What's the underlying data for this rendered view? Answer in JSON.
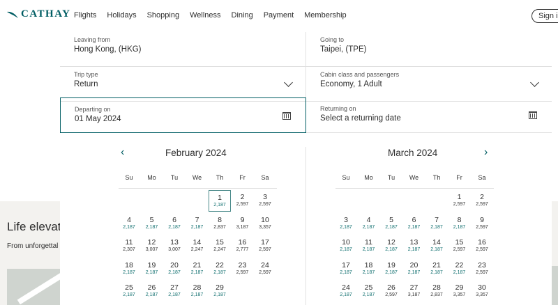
{
  "brand": {
    "name": "CATHAY",
    "accent": "#005d63"
  },
  "nav": [
    "Flights",
    "Holidays",
    "Shopping",
    "Wellness",
    "Dining",
    "Payment",
    "Membership"
  ],
  "signin": "Sign in",
  "background": {
    "heading": "Life elevat",
    "sub": "From unforgettal"
  },
  "form": {
    "leaving": {
      "label": "Leaving from",
      "value": "Hong Kong, (HKG)"
    },
    "going": {
      "label": "Going to",
      "value": "Taipei, (TPE)"
    },
    "trip": {
      "label": "Trip type",
      "value": "Return"
    },
    "cabin": {
      "label": "Cabin class and passengers",
      "value": "Economy, 1 Adult"
    },
    "depart": {
      "label": "Departing on",
      "value": "01 May 2024"
    },
    "return": {
      "label": "Returning on",
      "value": "Select a returning date"
    }
  },
  "weekdays": [
    "Su",
    "Mo",
    "Tu",
    "We",
    "Th",
    "Fr",
    "Sa"
  ],
  "months": [
    {
      "title": "February 2024",
      "start": 4,
      "selected": 1,
      "days": [
        [
          "1",
          "2,187"
        ],
        [
          "2",
          "2,597"
        ],
        [
          "3",
          "2,597"
        ],
        [
          "4",
          "2,187"
        ],
        [
          "5",
          "2,187"
        ],
        [
          "6",
          "2,187"
        ],
        [
          "7",
          "2,187"
        ],
        [
          "8",
          "2,837"
        ],
        [
          "9",
          "3,187"
        ],
        [
          "10",
          "3,357"
        ],
        [
          "11",
          "2,307"
        ],
        [
          "12",
          "3,007"
        ],
        [
          "13",
          "3,007"
        ],
        [
          "14",
          "2,247"
        ],
        [
          "15",
          "2,247"
        ],
        [
          "16",
          "2,777"
        ],
        [
          "17",
          "2,597"
        ],
        [
          "18",
          "2,187"
        ],
        [
          "19",
          "2,187"
        ],
        [
          "20",
          "2,187"
        ],
        [
          "21",
          "2,187"
        ],
        [
          "22",
          "2,187"
        ],
        [
          "23",
          "2,597"
        ],
        [
          "24",
          "2,597"
        ],
        [
          "25",
          "2,187"
        ],
        [
          "26",
          "2,187"
        ],
        [
          "27",
          "2,187"
        ],
        [
          "28",
          "2,187"
        ],
        [
          "29",
          "2,187"
        ]
      ],
      "dark": [
        "2",
        "3",
        "8",
        "9",
        "10",
        "11",
        "12",
        "13",
        "14",
        "15",
        "16",
        "17",
        "23",
        "24"
      ]
    },
    {
      "title": "March 2024",
      "start": 5,
      "selected": null,
      "days": [
        [
          "1",
          "2,597"
        ],
        [
          "2",
          "2,597"
        ],
        [
          "3",
          "2,187"
        ],
        [
          "4",
          "2,187"
        ],
        [
          "5",
          "2,187"
        ],
        [
          "6",
          "2,187"
        ],
        [
          "7",
          "2,187"
        ],
        [
          "8",
          "2,187"
        ],
        [
          "9",
          "2,597"
        ],
        [
          "10",
          "2,187"
        ],
        [
          "11",
          "2,187"
        ],
        [
          "12",
          "2,187"
        ],
        [
          "13",
          "2,187"
        ],
        [
          "14",
          "2,187"
        ],
        [
          "15",
          "2,597"
        ],
        [
          "16",
          "2,597"
        ],
        [
          "17",
          "2,187"
        ],
        [
          "18",
          "2,187"
        ],
        [
          "19",
          "2,187"
        ],
        [
          "20",
          "2,187"
        ],
        [
          "21",
          "2,187"
        ],
        [
          "22",
          "2,187"
        ],
        [
          "23",
          "2,597"
        ],
        [
          "24",
          "2,187"
        ],
        [
          "25",
          "2,187"
        ],
        [
          "26",
          "2,597"
        ],
        [
          "27",
          "3,187"
        ],
        [
          "28",
          "2,837"
        ],
        [
          "29",
          "3,357"
        ],
        [
          "30",
          "3,357"
        ]
      ],
      "dark": [
        "1",
        "2",
        "9",
        "15",
        "16",
        "23",
        "26",
        "27",
        "28",
        "29",
        "30"
      ]
    }
  ]
}
